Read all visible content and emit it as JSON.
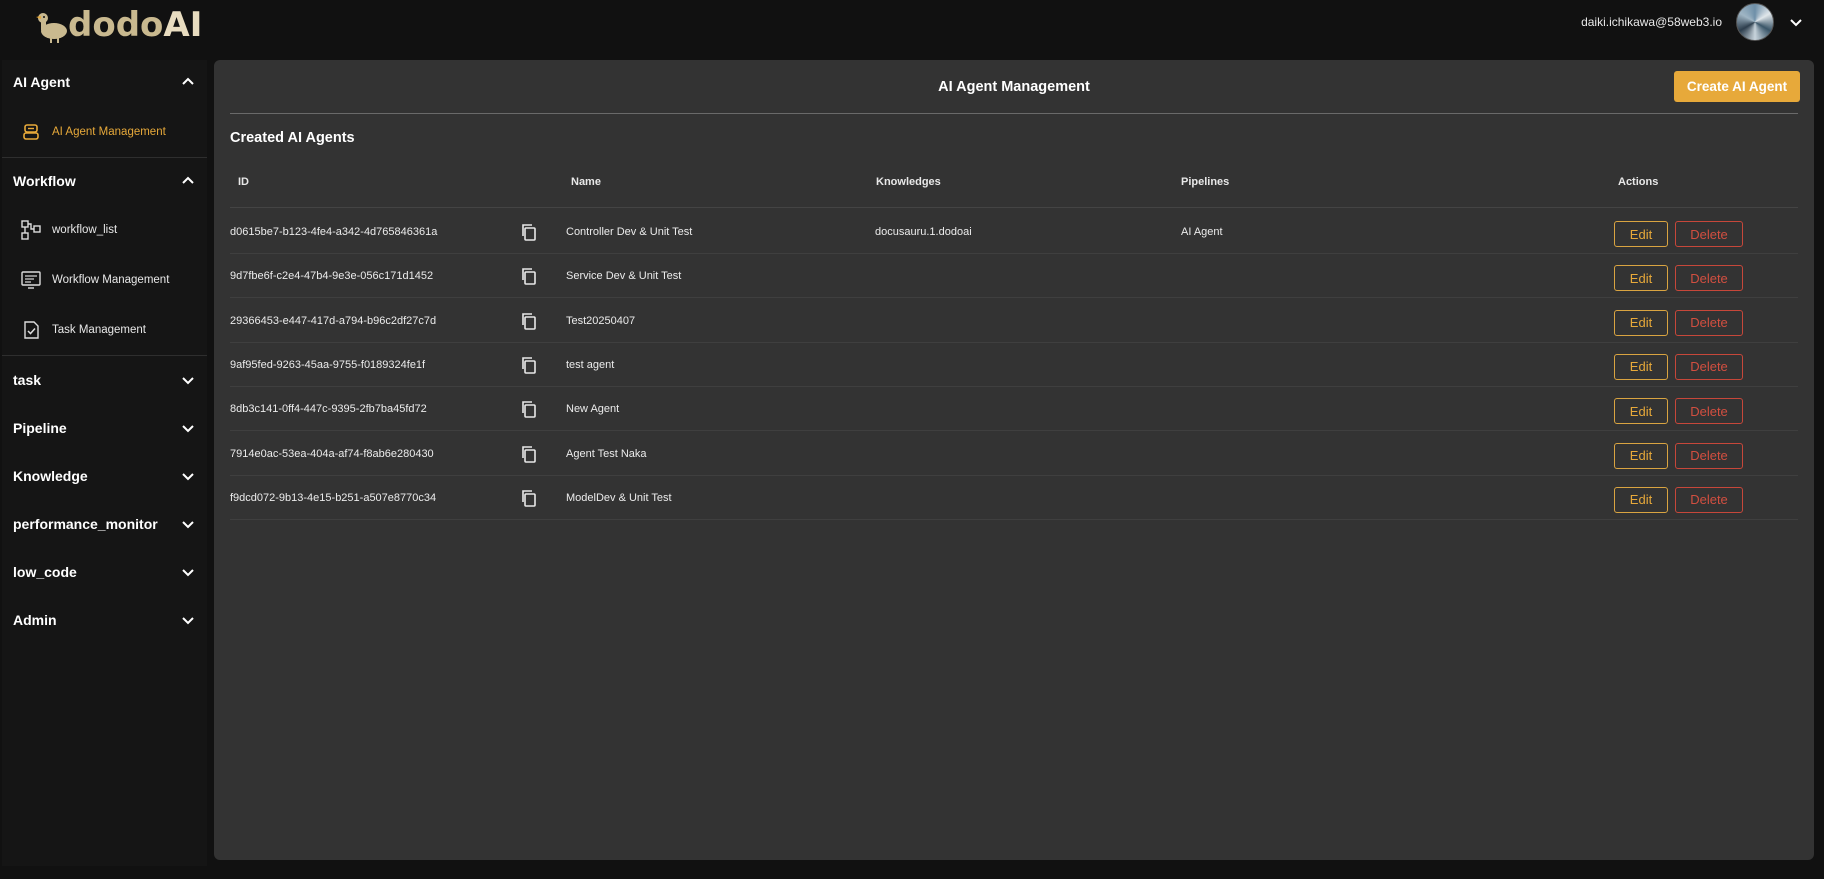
{
  "header": {
    "logo_text_dodo": "dodo",
    "logo_text_ai": "AI",
    "user_email": "daiki.ichikawa@58web3.io"
  },
  "sidebar": {
    "sections": [
      {
        "label": "AI Agent",
        "expanded": true
      },
      {
        "label": "Workflow",
        "expanded": true
      },
      {
        "label": "task",
        "expanded": false
      },
      {
        "label": "Pipeline",
        "expanded": false
      },
      {
        "label": "Knowledge",
        "expanded": false
      },
      {
        "label": "performance_monitor",
        "expanded": false
      },
      {
        "label": "low_code",
        "expanded": false
      },
      {
        "label": "Admin",
        "expanded": false
      }
    ],
    "items": [
      {
        "label": "AI Agent Management",
        "icon": "robot-icon",
        "active": true
      },
      {
        "label": "workflow_list",
        "icon": "flowchart-icon",
        "active": false
      },
      {
        "label": "Workflow Management",
        "icon": "workflow-board-icon",
        "active": false
      },
      {
        "label": "Task Management",
        "icon": "task-check-icon",
        "active": false
      }
    ]
  },
  "main": {
    "title": "AI Agent Management",
    "create_button": "Create AI Agent",
    "section_title": "Created AI Agents",
    "columns": [
      "ID",
      "Name",
      "Knowledges",
      "Pipelines",
      "Actions"
    ],
    "edit_label": "Edit",
    "delete_label": "Delete",
    "rows": [
      {
        "id": "d0615be7-b123-4fe4-a342-4d765846361a",
        "name": "Controller Dev & Unit Test",
        "knowledges": "docusauru.1.dodoai",
        "pipelines": "AI Agent"
      },
      {
        "id": "9d7fbe6f-c2e4-47b4-9e3e-056c171d1452",
        "name": "Service Dev & Unit Test",
        "knowledges": "",
        "pipelines": ""
      },
      {
        "id": "29366453-e447-417d-a794-b96c2df27c7d",
        "name": "Test20250407",
        "knowledges": "",
        "pipelines": ""
      },
      {
        "id": "9af95fed-9263-45aa-9755-f0189324fe1f",
        "name": "test agent",
        "knowledges": "",
        "pipelines": ""
      },
      {
        "id": "8db3c141-0ff4-447c-9395-2fb7ba45fd72",
        "name": "New Agent",
        "knowledges": "",
        "pipelines": ""
      },
      {
        "id": "7914e0ac-53ea-404a-af74-f8ab6e280430",
        "name": "Agent Test Naka",
        "knowledges": "",
        "pipelines": ""
      },
      {
        "id": "f9dcd072-9b13-4e15-b251-a507e8770c34",
        "name": "ModelDev & Unit Test",
        "knowledges": "",
        "pipelines": ""
      }
    ]
  },
  "colors": {
    "accent": "#e7a93a",
    "danger": "#d24f40",
    "panel": "#333333",
    "background": "#111111"
  }
}
